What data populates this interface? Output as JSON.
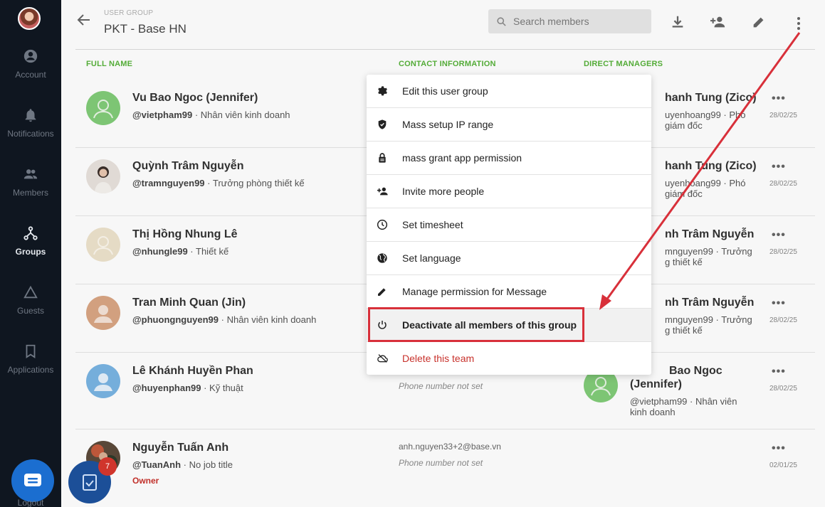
{
  "sidebar": {
    "items": [
      {
        "label": "Account",
        "icon": "account-circle-icon"
      },
      {
        "label": "Notifications",
        "icon": "bell-icon"
      },
      {
        "label": "Members",
        "icon": "people-icon"
      },
      {
        "label": "Groups",
        "icon": "groups-tree-icon",
        "active": true
      },
      {
        "label": "Guests",
        "icon": "triangle-icon"
      },
      {
        "label": "Applications",
        "icon": "bookmark-icon"
      }
    ],
    "logout": "Logout"
  },
  "header": {
    "overline": "USER GROUP",
    "title": "PKT - Base HN",
    "search_placeholder": "Search members"
  },
  "columns": {
    "full_name": "FULL NAME",
    "contact": "CONTACT INFORMATION",
    "managers": "DIRECT MANAGERS"
  },
  "rows": [
    {
      "name": "Vu Bao Ngoc (Jennifer)",
      "handle": "@vietpham99",
      "title": "Nhân viên kinh doanh",
      "mgr_name": "hanh Tung (Zico)",
      "mgr_sub1": "uyenhoang99 · Phó",
      "mgr_sub2": "giám đốc",
      "date": "28/02/25"
    },
    {
      "name": "Quỳnh Trâm Nguyễn",
      "handle": "@tramnguyen99",
      "title": "Trưởng phòng thiết kế",
      "mgr_name": "hanh Tung (Zico)",
      "mgr_sub1": "uyenhoang99 · Phó",
      "mgr_sub2": "giám đốc",
      "date": "28/02/25"
    },
    {
      "name": "Thị Hồng Nhung Lê",
      "handle": "@nhungle99",
      "title": "Thiết kế",
      "mgr_name": "nh Trâm Nguyễn",
      "mgr_sub1": "mnguyen99 · Trưởng",
      "mgr_sub2": "g thiết kế",
      "date": "28/02/25"
    },
    {
      "name": "Tran Minh Quan (Jin)",
      "handle": "@phuongnguyen99",
      "title": "Nhân viên kinh doanh",
      "mgr_name": "nh Trâm Nguyễn",
      "mgr_sub1": "mnguyen99 · Trưởng",
      "mgr_sub2": "g thiết kế",
      "date": "28/02/25"
    },
    {
      "name": "Lê Khánh Huyền Phan",
      "handle": "@huyenphan99",
      "title": "Kỹ thuật",
      "contact2": "Phone number not set",
      "mgr_name": "Bao Ngoc",
      "mgr_name2": "(Jennifer)",
      "mgr_sub1": "@vietpham99 · Nhân viên",
      "mgr_sub2": "kinh doanh",
      "date": "28/02/25"
    },
    {
      "name": "Nguyễn Tuấn Anh",
      "handle": "@TuanAnh",
      "title": "No job title",
      "owner": "Owner",
      "contact1": "anh.nguyen33+2@base.vn",
      "contact2": "Phone number not set",
      "date": "02/01/25"
    }
  ],
  "menu": {
    "items": [
      {
        "label": "Edit this user group",
        "icon": "gear-icon"
      },
      {
        "label": "Mass setup IP range",
        "icon": "shield-icon"
      },
      {
        "label": "mass grant app permission",
        "icon": "lock-icon"
      },
      {
        "label": "Invite more people",
        "icon": "person-add-icon"
      },
      {
        "label": "Set timesheet",
        "icon": "clock-icon"
      },
      {
        "label": "Set language",
        "icon": "globe-icon"
      },
      {
        "label": "Manage permission for Message",
        "icon": "pencil-icon"
      },
      {
        "label": "Deactivate all members of this group",
        "icon": "power-icon"
      },
      {
        "label": "Delete this team",
        "icon": "cloud-off-icon"
      }
    ]
  },
  "fab": {
    "badge": "7"
  },
  "colors": {
    "accent_green": "#57b23a",
    "danger": "#c8322c",
    "sidebar": "#0f1620",
    "callout": "#d8303a"
  }
}
